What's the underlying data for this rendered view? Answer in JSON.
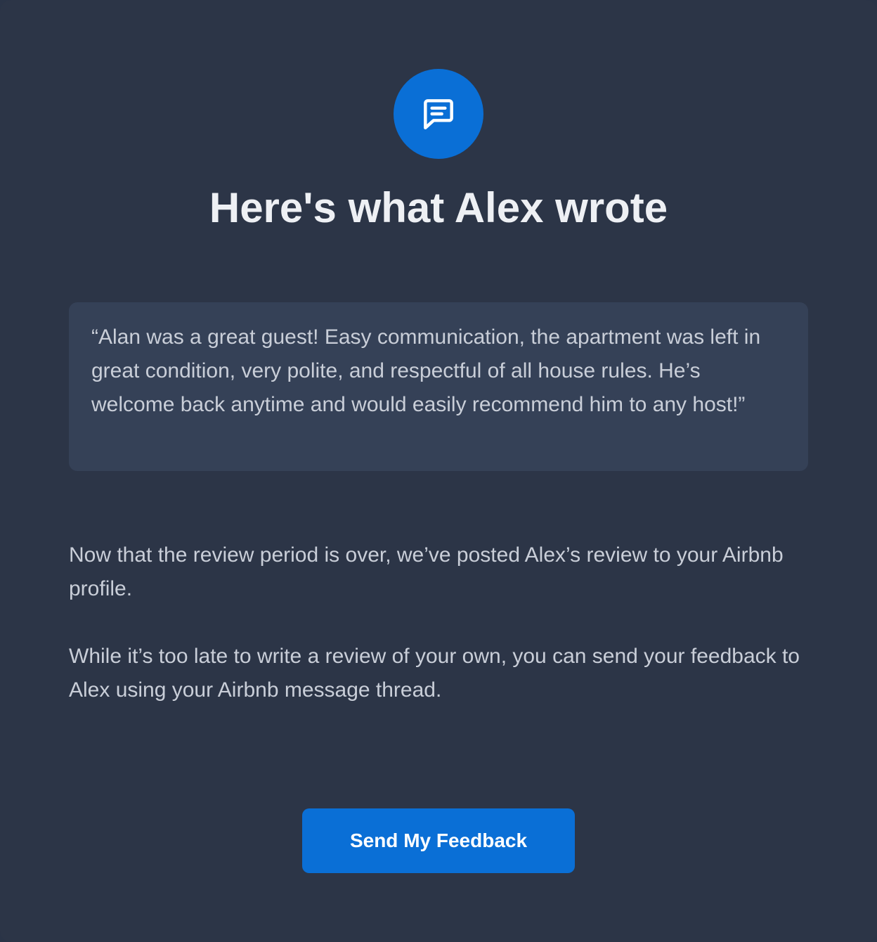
{
  "header": {
    "icon": "chat-message-icon",
    "title": "Here's what Alex wrote"
  },
  "review": {
    "quote": "“Alan was a great guest! Easy communication, the apartment was left in great condition, very polite, and respectful of all house rules. He’s welcome back anytime and would easily recommend him to any host!”"
  },
  "body": {
    "paragraph_1": "Now that the review period is over, we’ve posted Alex’s review to your Airbnb profile.",
    "paragraph_2": "While it’s too late to write a review of your own, you can send your feedback to Alex using your Airbnb message thread."
  },
  "cta": {
    "label": "Send My Feedback"
  },
  "colors": {
    "background": "#2c3547",
    "quote_background": "#354157",
    "accent": "#0a6fd6",
    "heading_text": "#eef0f4",
    "body_text": "#c9ced8"
  }
}
